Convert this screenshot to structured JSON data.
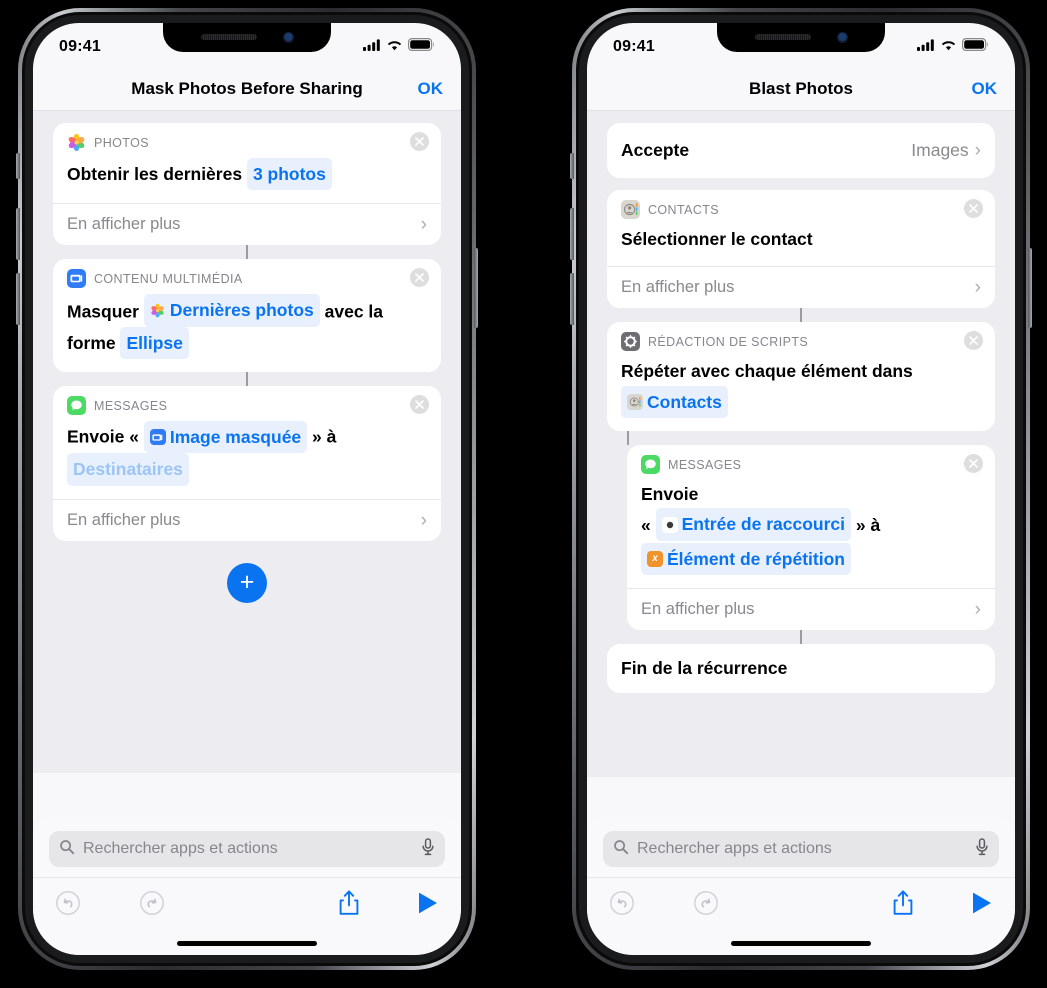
{
  "phones": [
    {
      "id": "phone-left",
      "status": {
        "time": "09:41",
        "cellular": "signal-icon",
        "wifi": "wifi-icon",
        "battery": "battery-icon"
      },
      "nav": {
        "title": "Mask Photos Before Sharing",
        "action": "OK"
      },
      "cards": [
        {
          "kind": "action",
          "category": "PHOTOS",
          "icon": "photos-icon",
          "parts": [
            {
              "t": "text",
              "v": "Obtenir les dernières "
            },
            {
              "t": "token",
              "v": "3 photos"
            }
          ],
          "more": "En afficher plus",
          "close": true
        },
        {
          "kind": "action",
          "category": "CONTENU MULTIMÉDIA",
          "icon": "media-icon",
          "parts": [
            {
              "t": "text",
              "v": "Masquer "
            },
            {
              "t": "token",
              "v": "Dernières photos",
              "icon": "photos-icon"
            },
            {
              "t": "text",
              "v": " avec la forme "
            },
            {
              "t": "token",
              "v": "Ellipse"
            }
          ],
          "more": null,
          "close": true
        },
        {
          "kind": "action",
          "category": "MESSAGES",
          "icon": "messages-icon",
          "parts": [
            {
              "t": "text",
              "v": "Envoie « "
            },
            {
              "t": "token",
              "v": "Image masquée",
              "icon": "media-icon"
            },
            {
              "t": "text",
              "v": " » à "
            },
            {
              "t": "token",
              "v": "Destinataires",
              "dim": true
            }
          ],
          "more": "En afficher plus",
          "close": true
        }
      ],
      "add_button": "+",
      "search": {
        "placeholder": "Rechercher apps et actions",
        "mic": "mic-icon",
        "glass": "search-icon"
      },
      "toolbar": {
        "undo": "undo-icon",
        "redo": "redo-icon",
        "share": "share-icon",
        "play": "play-icon"
      }
    },
    {
      "id": "phone-right",
      "status": {
        "time": "09:41",
        "cellular": "signal-icon",
        "wifi": "wifi-icon",
        "battery": "battery-icon"
      },
      "nav": {
        "title": "Blast Photos",
        "action": "OK"
      },
      "accept_row": {
        "label": "Accepte",
        "value": "Images",
        "chevron": "chevron-right-icon"
      },
      "cards": [
        {
          "kind": "action",
          "category": "CONTACTS",
          "icon": "contacts-icon",
          "parts": [
            {
              "t": "text",
              "v": "Sélectionner le contact"
            }
          ],
          "more": "En afficher plus",
          "close": true
        },
        {
          "kind": "action",
          "category": "RÉDACTION DE SCRIPTS",
          "icon": "scripting-icon",
          "parts": [
            {
              "t": "text",
              "v": "Répéter avec chaque élément dans "
            },
            {
              "t": "token",
              "v": "Contacts",
              "icon": "contacts-icon"
            }
          ],
          "more": null,
          "close": true
        },
        {
          "kind": "action",
          "indent": true,
          "category": "MESSAGES",
          "icon": "messages-icon",
          "parts": [
            {
              "t": "text",
              "v": "Envoie"
            },
            {
              "t": "br"
            },
            {
              "t": "text",
              "v": "« "
            },
            {
              "t": "token",
              "v": "Entrée de raccourci",
              "icon": "shortcut-input-icon"
            },
            {
              "t": "text",
              "v": " » à "
            },
            {
              "t": "br"
            },
            {
              "t": "token",
              "v": "Élément de répétition",
              "icon": "variable-icon"
            }
          ],
          "more": "En afficher plus",
          "close": true
        },
        {
          "kind": "plain",
          "label": "Fin de la récurrence"
        }
      ],
      "search": {
        "placeholder": "Rechercher apps et actions",
        "mic": "mic-icon",
        "glass": "search-icon"
      },
      "toolbar": {
        "undo": "undo-icon",
        "redo": "redo-icon",
        "share": "share-icon",
        "play": "play-icon"
      }
    }
  ],
  "colors": {
    "accent": "#0a74f0",
    "token_bg": "#e8f0fe",
    "screen_bg": "#ededf1",
    "messages_green": "#4cd964",
    "media_blue": "#2f7cf6",
    "variable_orange": "#f0932b",
    "scripting_gray": "#6d6d72"
  }
}
